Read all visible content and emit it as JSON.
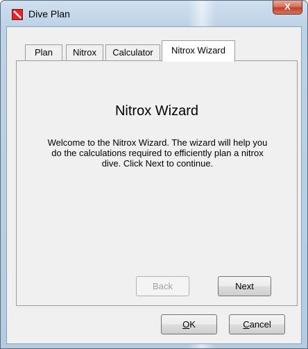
{
  "window": {
    "title": "Dive Plan",
    "close_glyph": "X"
  },
  "tabs": [
    {
      "label": "Plan"
    },
    {
      "label": "Nitrox"
    },
    {
      "label": "Calculator"
    },
    {
      "label": "Nitrox Wizard",
      "active": true
    }
  ],
  "wizard": {
    "title": "Nitrox Wizard",
    "text": "Welcome to the Nitrox Wizard.  The wizard will help you do the calculations required to efficiently plan a nitrox dive. Click Next to continue.",
    "back_label": "Back",
    "next_label": "Next",
    "back_enabled": false
  },
  "dialog": {
    "ok_mnemonic": "O",
    "ok_rest": "K",
    "cancel_mnemonic": "C",
    "cancel_rest": "ancel"
  },
  "icons": {
    "app": "app-logo-icon",
    "close": "close-icon"
  },
  "colors": {
    "app_icon_red": "#e8232a",
    "close_button_red": "#c0402b"
  }
}
